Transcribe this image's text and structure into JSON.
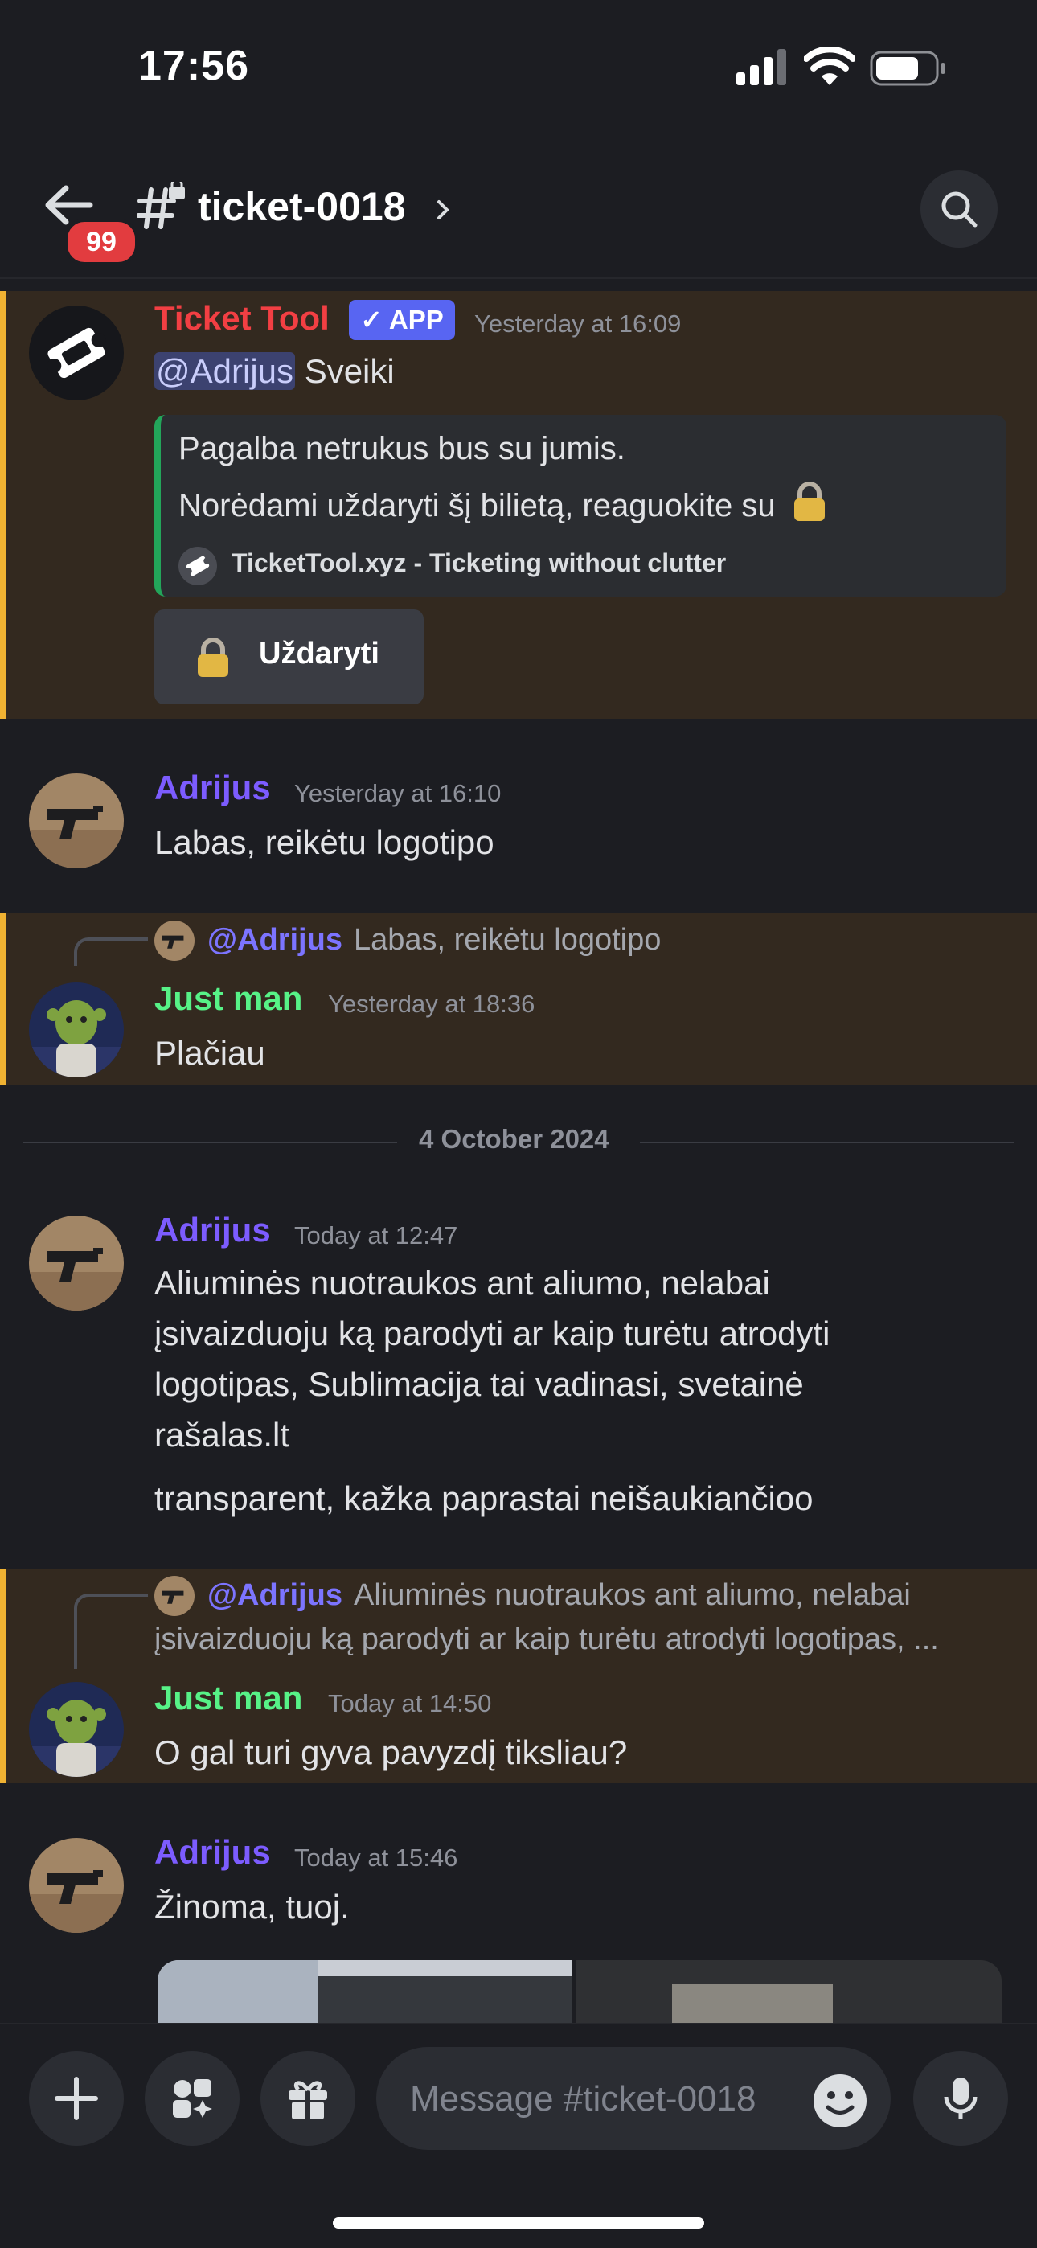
{
  "status_bar": {
    "time": "17:56"
  },
  "header": {
    "channel": "ticket-0018",
    "unread_badge": "99"
  },
  "messages": [
    {
      "author": "Ticket Tool",
      "author_color": "#f23f43",
      "app_tag": "APP",
      "timestamp": "Yesterday at 16:09",
      "mention": "@Adrijus",
      "text": "Sveiki",
      "embed": {
        "line1": "Pagalba netrukus bus su jumis.",
        "line2": "Norėdami uždaryti šį bilietą, reaguokite su",
        "footer": "TicketTool.xyz - Ticketing without clutter"
      },
      "button_label": "Uždaryti"
    },
    {
      "author": "Adrijus",
      "author_color": "#7c5cff",
      "timestamp": "Yesterday at 16:10",
      "text": "Labas, reikėtu logotipo"
    },
    {
      "reply_to": {
        "name": "@Adrijus",
        "text": "Labas, reikėtu logotipo"
      },
      "author": "Just man",
      "author_color": "#57f287",
      "timestamp": "Yesterday at 18:36",
      "text": "Plačiau"
    },
    {
      "author": "Adrijus",
      "timestamp": "Today at 12:47",
      "lines": [
        "Aliuminės nuotraukos ant aliumo, nelabai",
        "įsivaizduoju ką parodyti ar kaip turėtu atrodyti",
        "logotipas, Sublimacija tai vadinasi, svetainė",
        "rašalas.lt"
      ],
      "text2": "transparent, kažka paprastai neišaukiančioo"
    },
    {
      "reply_to": {
        "name": "@Adrijus",
        "text_line1": "Aliuminės nuotraukos ant aliumo, nelabai",
        "text_line2": "įsivaizduoju ką parodyti ar kaip turėtu atrodyti logotipas, ..."
      },
      "author": "Just man",
      "timestamp": "Today at 14:50",
      "text": "O gal turi gyva pavyzdį tiksliau?"
    },
    {
      "author": "Adrijus",
      "timestamp": "Today at 15:46",
      "text": "Žinoma, tuoj."
    }
  ],
  "date_divider": "4 October 2024",
  "composer": {
    "placeholder": "Message #ticket-0018"
  }
}
